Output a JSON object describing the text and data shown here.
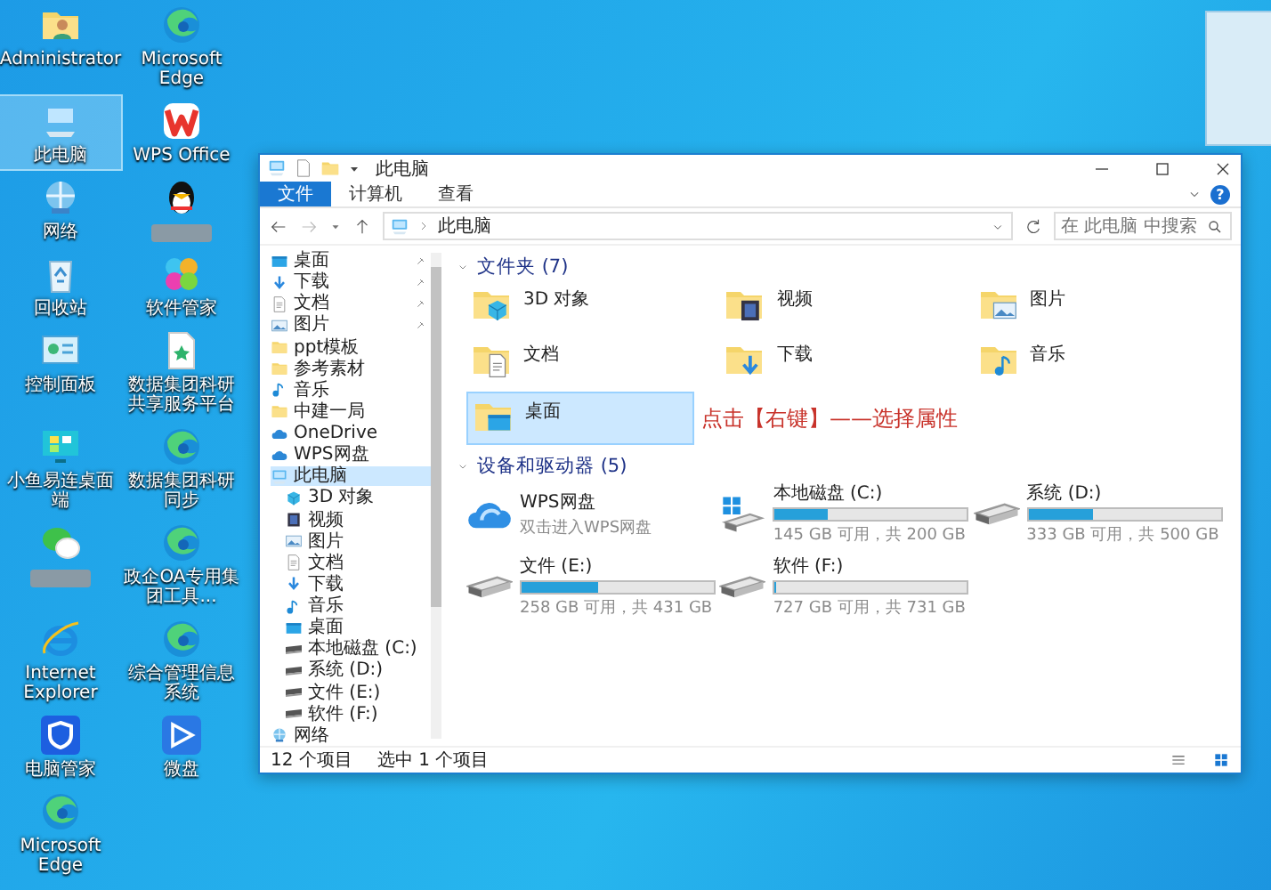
{
  "desktop_icons": [
    {
      "label": "Administrator",
      "kind": "user",
      "selected": false,
      "redacted": false
    },
    {
      "label": "Microsoft Edge",
      "kind": "swirl",
      "selected": false,
      "redacted": false
    },
    {
      "label": "此电脑",
      "kind": "pc",
      "selected": true,
      "redacted": false
    },
    {
      "label": "WPS Office",
      "kind": "wps",
      "selected": false,
      "redacted": false
    },
    {
      "label": "网络",
      "kind": "network",
      "selected": false,
      "redacted": false
    },
    {
      "kind": "penguin",
      "selected": false,
      "redacted": true
    },
    {
      "label": "回收站",
      "kind": "recycle",
      "selected": false,
      "redacted": false
    },
    {
      "label": "软件管家",
      "kind": "petals",
      "selected": false,
      "redacted": false
    },
    {
      "label": "控制面板",
      "kind": "panel",
      "selected": false,
      "redacted": false
    },
    {
      "label": "数据集团科研共享服务平台",
      "kind": "doc",
      "selected": false,
      "redacted": false
    },
    {
      "label": "小鱼易连桌面端",
      "kind": "monitor",
      "selected": false,
      "redacted": false
    },
    {
      "label": "数据集团科研同步",
      "kind": "swirl",
      "selected": false,
      "redacted": false
    },
    {
      "kind": "chat",
      "selected": false,
      "redacted": true
    },
    {
      "label": "政企OA专用集团工具...",
      "kind": "swirl",
      "selected": false,
      "redacted": false
    },
    {
      "label": "Internet Explorer",
      "kind": "ie",
      "selected": false,
      "redacted": false
    },
    {
      "label": "综合管理信息系统",
      "kind": "swirl",
      "selected": false,
      "redacted": false
    },
    {
      "label": "电脑管家",
      "kind": "shield",
      "selected": false,
      "redacted": false
    },
    {
      "label": "微盘",
      "kind": "play",
      "selected": false,
      "redacted": false
    },
    {
      "label": "Microsoft Edge",
      "kind": "swirl",
      "selected": false,
      "redacted": false
    }
  ],
  "window": {
    "title": "此电脑",
    "help_button": "?",
    "ribbon_tabs": [
      {
        "label": "文件",
        "selected": true
      },
      {
        "label": "计算机",
        "selected": false
      },
      {
        "label": "查看",
        "selected": false
      }
    ],
    "address": "此电脑",
    "search": {
      "placeholder": "在 此电脑 中搜索"
    },
    "nav": [
      {
        "label": "桌面",
        "kind": "desktop",
        "pinned": true,
        "selected": false
      },
      {
        "label": "下载",
        "kind": "download",
        "pinned": true,
        "selected": false
      },
      {
        "label": "文档",
        "kind": "docs",
        "pinned": true,
        "selected": false
      },
      {
        "label": "图片",
        "kind": "pictures",
        "pinned": true,
        "selected": false
      },
      {
        "label": "ppt模板",
        "kind": "folder",
        "pinned": false,
        "selected": false
      },
      {
        "label": "参考素材",
        "kind": "folder",
        "pinned": false,
        "selected": false
      },
      {
        "label": "音乐",
        "kind": "music",
        "pinned": false,
        "selected": false
      },
      {
        "label": "中建一局",
        "kind": "folder",
        "pinned": false,
        "selected": false
      },
      {
        "label": "OneDrive",
        "kind": "cloud",
        "pinned": false,
        "selected": false
      },
      {
        "label": "WPS网盘",
        "kind": "cloud",
        "pinned": false,
        "selected": false
      },
      {
        "label": "此电脑",
        "kind": "pc",
        "pinned": false,
        "selected": true,
        "children": [
          {
            "label": "3D 对象",
            "kind": "cube",
            "pinned": false,
            "selected": false
          },
          {
            "label": "视频",
            "kind": "video",
            "pinned": false,
            "selected": false
          },
          {
            "label": "图片",
            "kind": "pictures",
            "pinned": false,
            "selected": false
          },
          {
            "label": "文档",
            "kind": "docs",
            "pinned": false,
            "selected": false
          },
          {
            "label": "下载",
            "kind": "download",
            "pinned": false,
            "selected": false
          },
          {
            "label": "音乐",
            "kind": "music",
            "pinned": false,
            "selected": false
          },
          {
            "label": "桌面",
            "kind": "desktop",
            "pinned": false,
            "selected": false
          },
          {
            "label": "本地磁盘 (C:)",
            "kind": "drive",
            "pinned": false,
            "selected": false
          },
          {
            "label": "系统 (D:)",
            "kind": "drive",
            "pinned": false,
            "selected": false
          },
          {
            "label": "文件 (E:)",
            "kind": "drive",
            "pinned": false,
            "selected": false
          },
          {
            "label": "软件 (F:)",
            "kind": "drive",
            "pinned": false,
            "selected": false
          }
        ]
      },
      {
        "label": "网络",
        "kind": "network",
        "pinned": false,
        "selected": false
      }
    ],
    "folders_header": "文件夹 (7)",
    "folders": [
      {
        "label": "3D 对象",
        "kind": "cube",
        "selected": false
      },
      {
        "label": "视频",
        "kind": "video",
        "selected": false
      },
      {
        "label": "图片",
        "kind": "pictures",
        "selected": false
      },
      {
        "label": "文档",
        "kind": "docs",
        "selected": false
      },
      {
        "label": "下载",
        "kind": "download",
        "selected": false
      },
      {
        "label": "音乐",
        "kind": "music",
        "selected": false
      },
      {
        "label": "桌面",
        "kind": "desktop",
        "selected": true
      }
    ],
    "annotation": "点击【右键】——选择属性",
    "devices_header": "设备和驱动器 (5)",
    "drives": [
      {
        "kind": "cloud",
        "name": "WPS网盘",
        "subtitle": "双击进入WPS网盘"
      },
      {
        "kind": "system-disk",
        "name": "本地磁盘 (C:)",
        "level": 0.275,
        "reading": "145 GB 可用，共 200 GB"
      },
      {
        "kind": "disk",
        "name": "系统 (D:)",
        "level": 0.334,
        "reading": "333 GB 可用，共 500 GB"
      },
      {
        "kind": "disk",
        "name": "文件 (E:)",
        "level": 0.401,
        "reading": "258 GB 可用，共 431 GB"
      },
      {
        "kind": "disk",
        "name": "软件 (F:)",
        "level": 0.005,
        "reading": "727 GB 可用，共 731 GB"
      }
    ],
    "status": {
      "count": "12 个项目",
      "selection": "选中 1 个项目"
    }
  }
}
